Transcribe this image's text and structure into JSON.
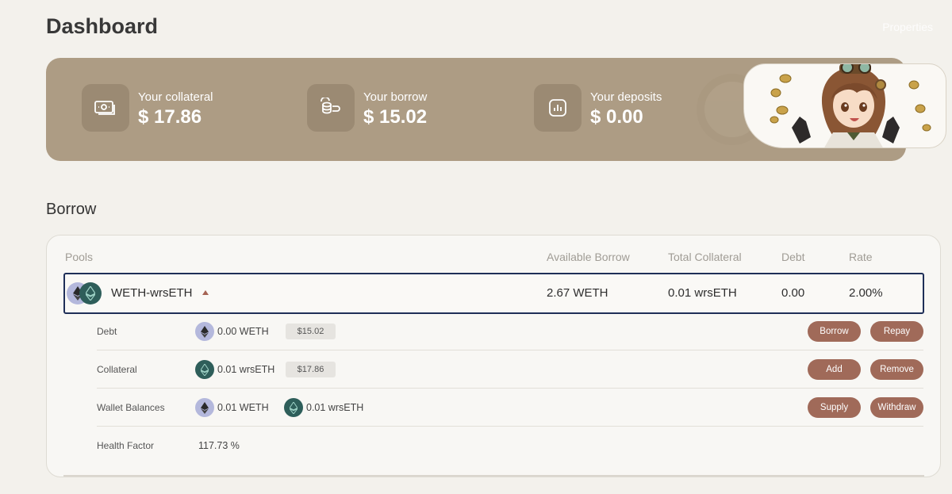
{
  "page": {
    "title": "Dashboard",
    "properties_link": "Properties"
  },
  "summary": {
    "collateral": {
      "label": "Your collateral",
      "value": "$ 17.86",
      "icon": "cash-icon"
    },
    "borrow": {
      "label": "Your borrow",
      "value": "$ 15.02",
      "icon": "coin-hand-icon"
    },
    "deposits": {
      "label": "Your deposits",
      "value": "$ 0.00",
      "icon": "bar-chart-icon"
    }
  },
  "borrow_section": {
    "title": "Borrow",
    "columns": {
      "pools": "Pools",
      "available_borrow": "Available Borrow",
      "total_collateral": "Total Collateral",
      "debt": "Debt",
      "rate": "Rate"
    },
    "pool": {
      "name": "WETH-wrsETH",
      "available_borrow": "2.67 WETH",
      "total_collateral": "0.01 wrsETH",
      "debt": "0.00",
      "rate": "2.00%"
    },
    "details": {
      "debt": {
        "label": "Debt",
        "amount": "0.00 WETH",
        "usd": "$15.02",
        "buttons": [
          "Borrow",
          "Repay"
        ]
      },
      "collateral": {
        "label": "Collateral",
        "amount": "0.01 wrsETH",
        "usd": "$17.86",
        "buttons": [
          "Add",
          "Remove"
        ]
      },
      "wallet": {
        "label": "Wallet Balances",
        "amount_weth": "0.01 WETH",
        "amount_wrseth": "0.01 wrsETH",
        "buttons": [
          "Supply",
          "Withdraw"
        ]
      },
      "health": {
        "label": "Health Factor",
        "value": "117.73 %"
      }
    }
  },
  "colors": {
    "banner": "#ad9c84",
    "button": "#a06a59",
    "pool_border": "#1f2f58",
    "weth_coin": "#b4b8dc",
    "wrseth_coin": "#2e5e5a"
  }
}
